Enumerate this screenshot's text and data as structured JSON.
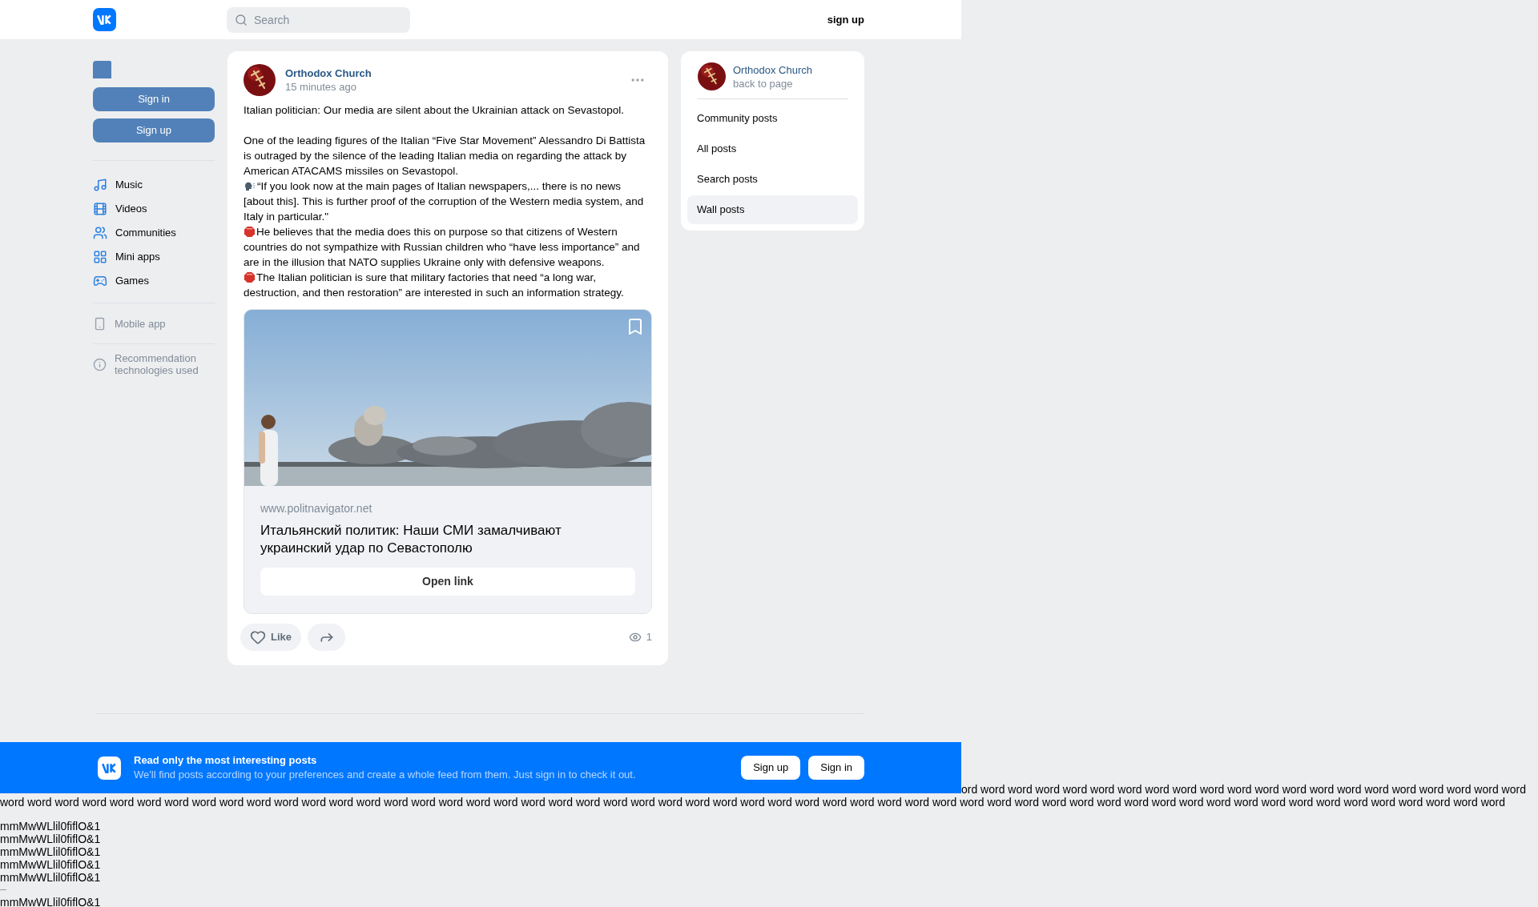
{
  "header": {
    "search": {
      "placeholder": "Search"
    },
    "sign_up": "sign up"
  },
  "sidebar": {
    "buttons": [
      "Sign in",
      "Sign up"
    ],
    "menu": [
      {
        "label": "Music",
        "kind": "music"
      },
      {
        "label": "Videos",
        "kind": "video"
      },
      {
        "label": "Communities",
        "kind": "people"
      },
      {
        "label": "Mini apps",
        "kind": "apps"
      },
      {
        "label": "Games",
        "kind": "games"
      }
    ],
    "extra": [
      {
        "label": "Mobile app",
        "kind": "phone"
      },
      {
        "label": "Recommendation technologies used",
        "kind": "info"
      }
    ]
  },
  "post": {
    "author": "Orthodox Church",
    "time": "15 minutes ago",
    "paragraphs": [
      {
        "kind": "plain",
        "text": "Italian politician: Our media are silent about the Ukrainian attack on Sevastopol."
      },
      {
        "kind": "plain",
        "text": "One of the leading figures of the Italian “Five Star Movement” Alessandro Di Battista is outraged by the silence of the leading Italian media on regarding the attack by American ATACAMS missiles on Sevastopol."
      },
      {
        "kind": "speaking-head",
        "text": "“If you look now at the main pages of Italian newspapers,... there is no news [about this]. This is further proof of the corruption of the Western media system, and Italy in particular.\""
      },
      {
        "kind": "stop-sign",
        "text": "He believes that the media does this on purpose so that citizens of Western countries do not sympathize with Russian children who “have less importance” and are in the illusion that NATO supplies Ukraine only with defensive weapons."
      },
      {
        "kind": "stop-sign",
        "text": "The Italian politician is sure that military factories that need “a long war, destruction, and then restoration” are interested in such an information strategy."
      }
    ],
    "link": {
      "domain": "www.politnavigator.net",
      "title": "Итальянский политик: Наши СМИ замалчивают украинский удар по Севастополю",
      "button": "Open link"
    },
    "like": "Like",
    "views": "1"
  },
  "right_panel": {
    "name": "Orthodox Church",
    "subtitle": "back to page",
    "items": [
      {
        "label": "Community posts",
        "selected": false
      },
      {
        "label": "All posts",
        "selected": false
      },
      {
        "label": "Search posts",
        "selected": false
      },
      {
        "label": "Wall posts",
        "selected": true
      }
    ]
  },
  "banner": {
    "title": "Read only the most interesting posts",
    "text": "We'll find posts according to your preferences and create a whole feed from them. Just sign in to check it out.",
    "buttons": [
      "Sign up",
      "Sign in"
    ]
  },
  "filler": {
    "word_lines": [
      "ord word word word word word word word word word word word word word word word word word word word word",
      "word word word word word word word word word word word word word word word word word word word word word word word word word word word word word word word word word word word word word word word word word word word word word word word word word word word word word word word"
    ],
    "sample_lines": [
      "mmMwWLlil0fiflO&1",
      "mmMwWLlil0fiflO&1",
      "mmMwWLlil0fiflO&1",
      "mmMwWLlil0fiflO&1",
      "mmMwWLlil0fiflO&1",
      "mmMwWLlil0fiflO&1"
    ]
  }
}
